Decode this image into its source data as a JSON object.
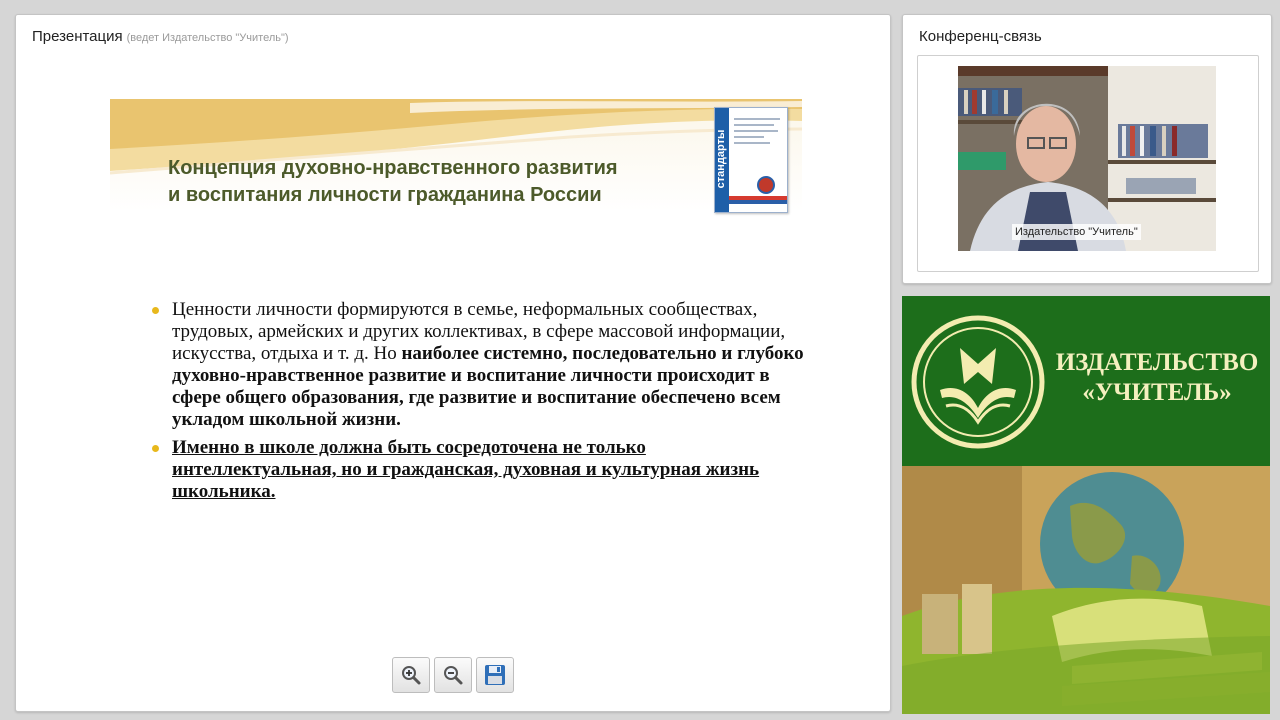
{
  "presentation": {
    "title": "Презентация",
    "subtitle": "(ведет Издательство \"Учитель\")",
    "slide": {
      "title_line1": "Концепция духовно-нравственного развития",
      "title_line2": "и воспитания личности  гражданина России",
      "book_spine": "стандарты",
      "bullet1_normal": "Ценности личности формируются в семье, неформальных сообществах, трудовых, армейских и других коллективах, в сфере массовой информации, искусства, отдыха и т. д. Но ",
      "bullet1_bold": "наиболее системно, последовательно и глубоко духовно-нравственное развитие и воспитание личности происходит в сфере общего образования, где развитие и воспитание обеспечено всем укладом школьной жизни.",
      "bullet2": "Именно в школе должна быть сосредоточена не только интеллектуальная, но и гражданская, духовная и культурная жизнь школьника."
    },
    "toolbar": {
      "zoom_in": "zoom-in-icon",
      "zoom_out": "zoom-out-icon",
      "save": "floppy-disk-icon"
    }
  },
  "conference": {
    "title": "Конференц-связь",
    "participant_name": "Издательство \"Учитель\""
  },
  "publisher": {
    "line1": "ИЗДАТЕЛЬСТВО",
    "line2": "«УЧИТЕЛЬ»"
  },
  "colors": {
    "publisher_green": "#1d6e1b",
    "publisher_text": "#f5f0bf",
    "slide_title": "#4c5a2a",
    "bullet_dot": "#e8b81c"
  }
}
